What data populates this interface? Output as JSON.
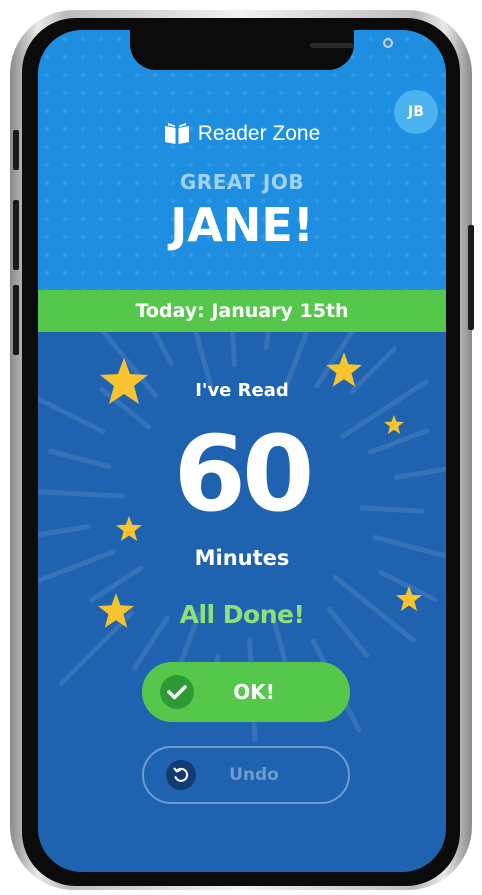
{
  "app": {
    "brand_name": "Reader Zone",
    "avatar_initials": "JB"
  },
  "header": {
    "greeting_line": "GREAT JOB",
    "reader_name": "JANE!"
  },
  "date_bar": {
    "text": "Today: January 15th"
  },
  "summary": {
    "read_label": "I've Read",
    "minutes_value": "60",
    "minutes_label": "Minutes",
    "status_text": "All Done!"
  },
  "actions": {
    "ok_label": "OK!",
    "undo_label": "Undo"
  },
  "icons": [
    "book-icon",
    "star-icon",
    "check-icon",
    "undo-icon"
  ],
  "colors": {
    "top_blue": "#1e8fe0",
    "bottom_blue": "#1f63b0",
    "green": "#55c84c",
    "dark_green": "#2e9a35",
    "star_yellow": "#f7c32e",
    "done_green": "#8fe07a"
  }
}
